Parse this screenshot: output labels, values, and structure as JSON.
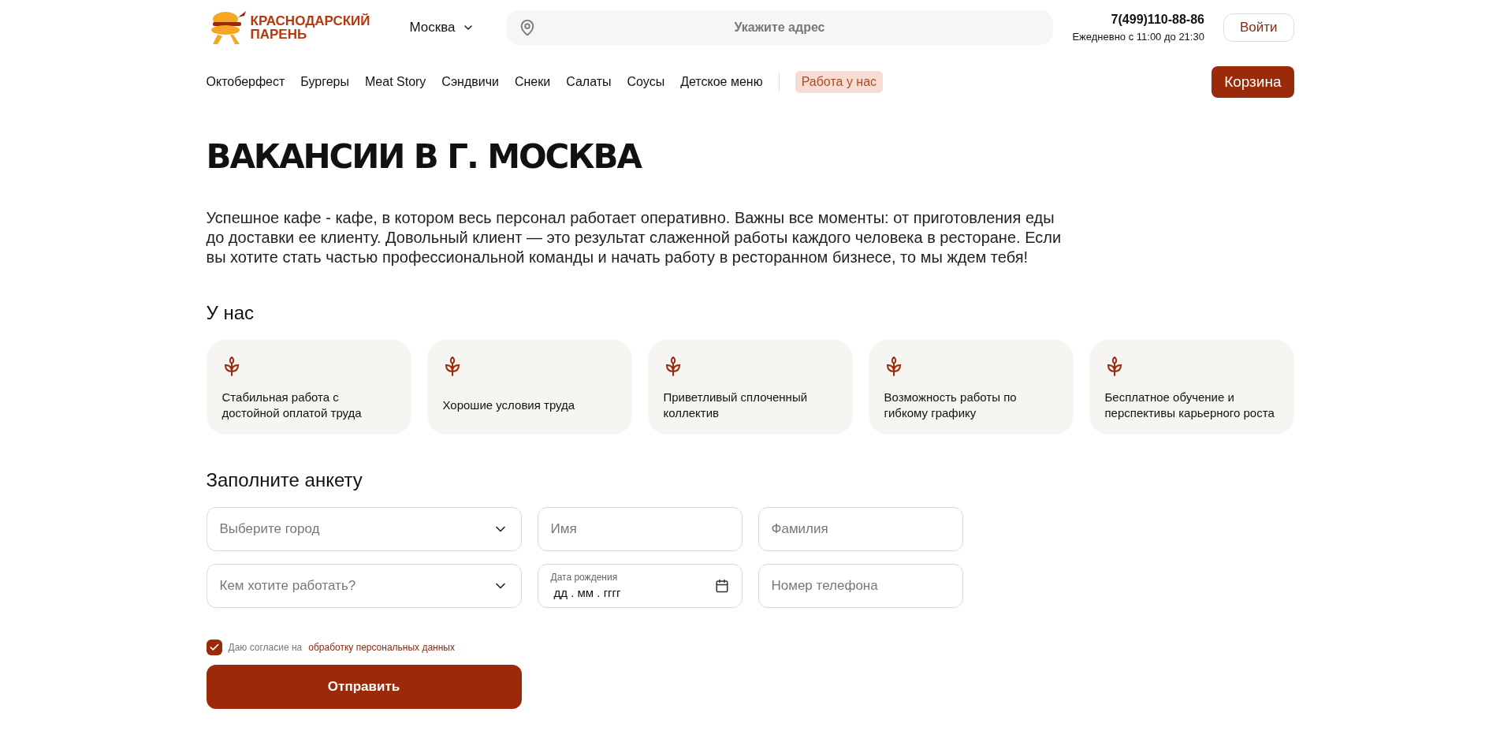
{
  "header": {
    "logo_lines": [
      "КРАСНОДАРСКИЙ",
      "ПАРЕНЬ"
    ],
    "city": "Москва",
    "address": {
      "placeholder": "Укажите адрес"
    },
    "phone": "7(499)110-88-86",
    "hours": "Ежедневно с 11:00 до 21:30",
    "login": "Войти"
  },
  "nav": {
    "items": [
      {
        "label": "Октоберфест",
        "selected": false
      },
      {
        "label": "Бургеры",
        "selected": false
      },
      {
        "label": "Meat Story",
        "selected": false
      },
      {
        "label": "Сэндвичи",
        "selected": false
      },
      {
        "label": "Снеки",
        "selected": false
      },
      {
        "label": "Салаты",
        "selected": false
      },
      {
        "label": "Соусы",
        "selected": false
      },
      {
        "label": "Детское меню",
        "selected": false
      }
    ],
    "extra": [
      {
        "label": "Работа у нас",
        "selected": true
      }
    ],
    "cart": "Корзина"
  },
  "title": "ВАКАНСИИ В Г. МОСКВА",
  "intro": "Успешное кафе - кафе, в котором весь персонал работает оперативно. Важны все моменты: от приготовления еды до доставки ее клиенту. Довольный клиент — это результат слаженной работы каждого человека в ресторане. Если вы хотите стать частью профессиональной команды и начать работу в ресторанном бизнесе, то мы ждем тебя!",
  "perks_title": "У нас",
  "perks": [
    "Стабильная работа с достойной оплатой труда",
    "Хорошие условия труда",
    "Приветливый сплоченный коллектив",
    "Возможность работы по гибкому графику",
    "Бесплатное обучение и перспективы карьерного роста"
  ],
  "form": {
    "title": "Заполните анкету",
    "fields": [
      {
        "kind": "select",
        "placeholder": "Выберите город"
      },
      {
        "kind": "text",
        "placeholder": "Имя"
      },
      {
        "kind": "text",
        "placeholder": "Фамилия"
      },
      {
        "kind": "select",
        "placeholder": "Кем хотите работать?"
      },
      {
        "kind": "date",
        "label": "Дата рождения",
        "value": "дд . мм . гггг"
      },
      {
        "kind": "text",
        "placeholder": "Номер телефона"
      }
    ],
    "consent": {
      "checked": true,
      "text": "Даю согласие на",
      "link": "обработку персональных данных"
    },
    "submit": "Отправить"
  }
}
